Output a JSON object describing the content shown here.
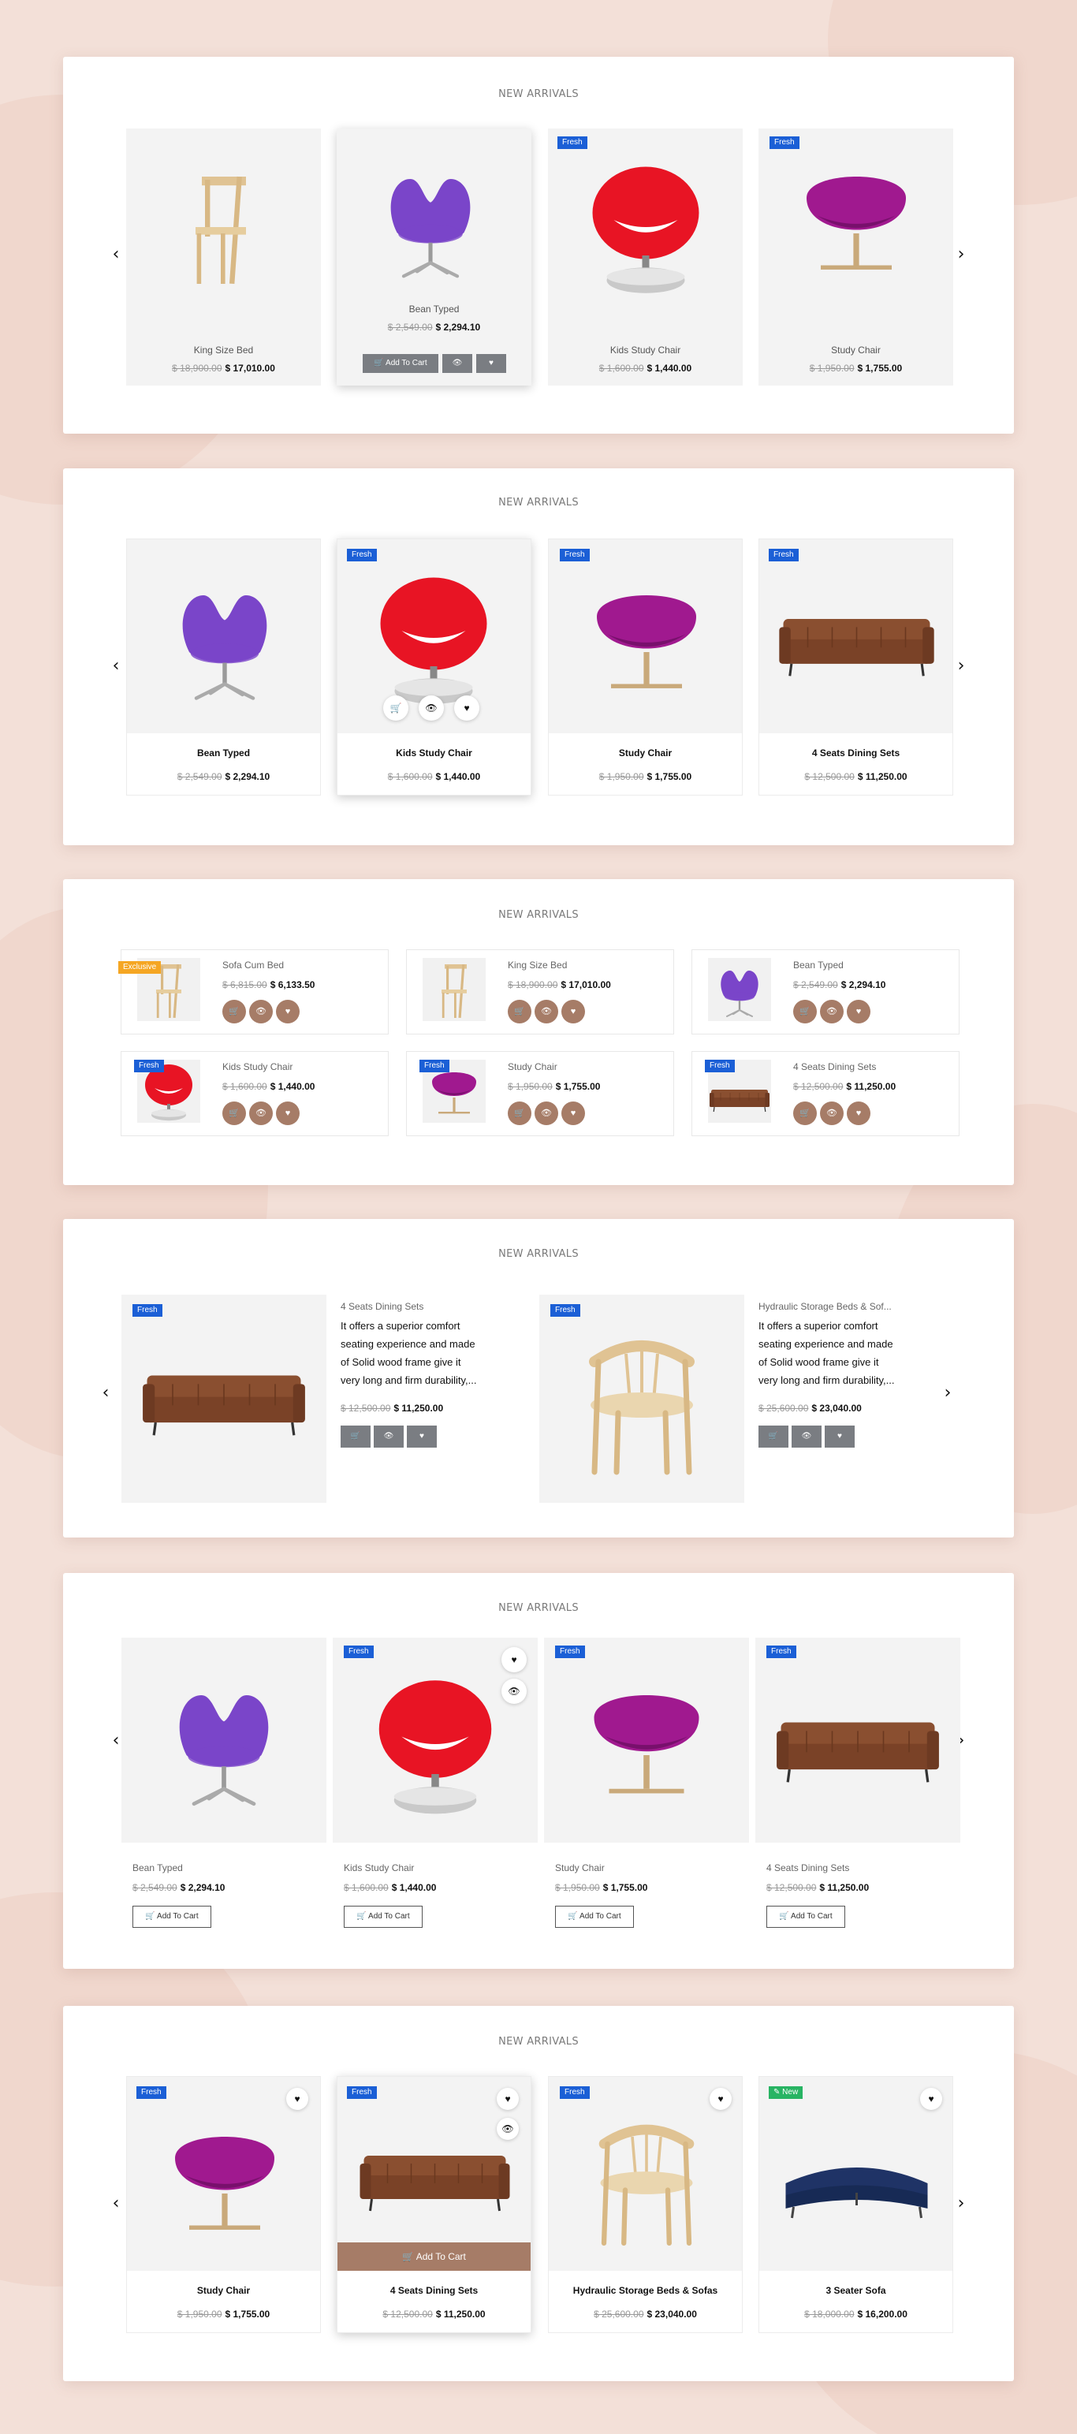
{
  "section_title": "NEW ARRIVALS",
  "arrows": {
    "prev": "‹",
    "next": "›"
  },
  "icons": {
    "cart": "🛒",
    "eye": "👁",
    "heart": "♥",
    "tag": "✎"
  },
  "colors": {
    "badge_fresh": "#1b5fd6",
    "badge_new": "#28b463",
    "badge_exclusive": "#f5a623",
    "action_brown": "#a67c67",
    "action_gray": "#7a7d82"
  },
  "s1": {
    "cards": [
      {
        "name": "King Size Bed",
        "old": "$ 18,900.00",
        "price": "$ 17,010.00"
      },
      {
        "name": "Bean Typed",
        "old": "$ 2,549.00",
        "price": "$ 2,294.10",
        "add": "Add To Cart"
      },
      {
        "badge": "Fresh",
        "name": "Kids Study Chair",
        "old": "$ 1,600.00",
        "price": "$ 1,440.00"
      },
      {
        "badge": "Fresh",
        "name": "Study Chair",
        "old": "$ 1,950.00",
        "price": "$ 1,755.00"
      }
    ]
  },
  "s2": {
    "cards": [
      {
        "name": "Bean Typed",
        "old": "$ 2,549.00",
        "price": "$ 2,294.10"
      },
      {
        "badge": "Fresh",
        "name": "Kids Study Chair",
        "old": "$ 1,600.00",
        "price": "$ 1,440.00"
      },
      {
        "badge": "Fresh",
        "name": "Study Chair",
        "old": "$ 1,950.00",
        "price": "$ 1,755.00"
      },
      {
        "badge": "Fresh",
        "name": "4 Seats Dining Sets",
        "old": "$ 12,500.00",
        "price": "$ 11,250.00"
      }
    ]
  },
  "s3": {
    "items": [
      {
        "badge": "Exclusive",
        "name": "Sofa Cum Bed",
        "old": "$ 6,815.00",
        "price": "$ 6,133.50"
      },
      {
        "name": "King Size Bed",
        "old": "$ 18,900.00",
        "price": "$ 17,010.00"
      },
      {
        "name": "Bean Typed",
        "old": "$ 2,549.00",
        "price": "$ 2,294.10"
      },
      {
        "badge": "Fresh",
        "name": "Kids Study Chair",
        "old": "$ 1,600.00",
        "price": "$ 1,440.00"
      },
      {
        "badge": "Fresh",
        "name": "Study Chair",
        "old": "$ 1,950.00",
        "price": "$ 1,755.00"
      },
      {
        "badge": "Fresh",
        "name": "4 Seats Dining Sets",
        "old": "$ 12,500.00",
        "price": "$ 11,250.00"
      }
    ]
  },
  "s4": {
    "items": [
      {
        "badge": "Fresh",
        "name": "4 Seats Dining Sets",
        "desc1": "It offers a superior comfort",
        "desc2": "seating experience and made",
        "desc3": "of Solid wood frame give it",
        "desc4": "very long and firm durability,...",
        "old": "$ 12,500.00",
        "price": "$ 11,250.00"
      },
      {
        "badge": "Fresh",
        "name": "Hydraulic Storage Beds & Sof...",
        "desc1": "It offers a superior comfort",
        "desc2": "seating experience and made",
        "desc3": "of Solid wood frame give it",
        "desc4": "very long and firm durability,...",
        "old": "$ 25,600.00",
        "price": "$ 23,040.00"
      }
    ]
  },
  "s5": {
    "cards": [
      {
        "name": "Bean Typed",
        "old": "$ 2,549.00",
        "price": "$ 2,294.10",
        "add": "Add To Cart"
      },
      {
        "badge": "Fresh",
        "name": "Kids Study Chair",
        "old": "$ 1,600.00",
        "price": "$ 1,440.00",
        "add": "Add To Cart"
      },
      {
        "badge": "Fresh",
        "name": "Study Chair",
        "old": "$ 1,950.00",
        "price": "$ 1,755.00",
        "add": "Add To Cart"
      },
      {
        "badge": "Fresh",
        "name": "4 Seats Dining Sets",
        "old": "$ 12,500.00",
        "price": "$ 11,250.00",
        "add": "Add To Cart"
      }
    ]
  },
  "s6": {
    "cards": [
      {
        "badge": "Fresh",
        "name": "Study Chair",
        "old": "$ 1,950.00",
        "price": "$ 1,755.00"
      },
      {
        "badge": "Fresh",
        "name": "4 Seats Dining Sets",
        "old": "$ 12,500.00",
        "price": "$ 11,250.00",
        "add": "Add To Cart"
      },
      {
        "badge": "Fresh",
        "name": "Hydraulic Storage Beds & Sofas",
        "old": "$ 25,600.00",
        "price": "$ 23,040.00"
      },
      {
        "badge": "New",
        "name": "3 Seater Sofa",
        "old": "$ 18,000.00",
        "price": "$ 16,200.00"
      }
    ]
  }
}
